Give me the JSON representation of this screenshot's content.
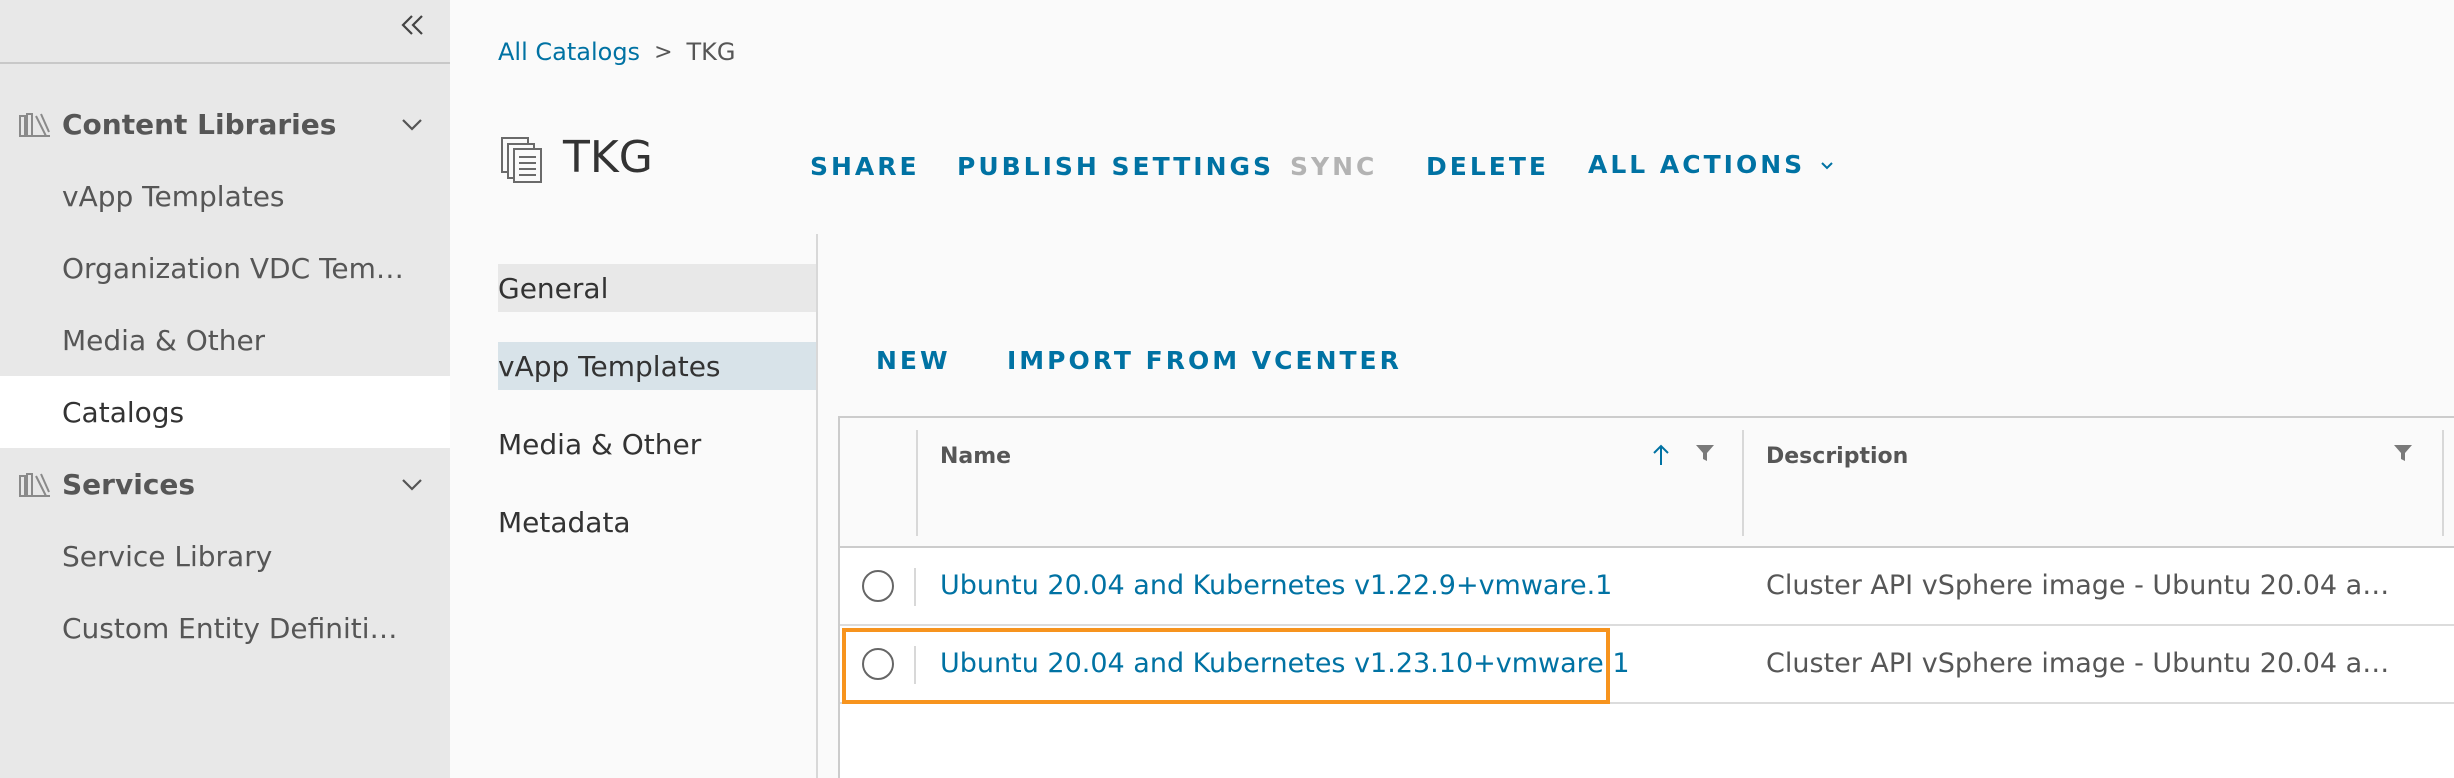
{
  "sidebar": {
    "groups": [
      {
        "label": "Content Libraries",
        "icon": "books-icon",
        "items": [
          {
            "label": "vApp Templates"
          },
          {
            "label": "Organization VDC Templates"
          },
          {
            "label": "Media & Other"
          },
          {
            "label": "Catalogs",
            "active": true
          }
        ]
      },
      {
        "label": "Services",
        "icon": "books-icon",
        "items": [
          {
            "label": "Service Library"
          },
          {
            "label": "Custom Entity Definitions"
          }
        ]
      }
    ]
  },
  "breadcrumb": {
    "parent": "All Catalogs",
    "separator": ">",
    "current": "TKG"
  },
  "page": {
    "title": "TKG"
  },
  "actions": {
    "share": "SHARE",
    "publish_settings": "PUBLISH SETTINGS",
    "sync": "SYNC",
    "delete": "DELETE",
    "all_actions": "ALL ACTIONS"
  },
  "tabs": [
    {
      "label": "General"
    },
    {
      "label": "vApp Templates",
      "selected": true
    },
    {
      "label": "Media & Other"
    },
    {
      "label": "Metadata"
    }
  ],
  "sub_actions": {
    "new": "NEW",
    "import": "IMPORT FROM VCENTER"
  },
  "grid": {
    "columns": {
      "name": "Name",
      "description": "Description"
    },
    "rows": [
      {
        "name": "Ubuntu 20.04 and Kubernetes v1.22.9+vmware.1",
        "description": "Cluster API vSphere image - Ubuntu 20.04 and Kubernetes"
      },
      {
        "name": "Ubuntu 20.04 and Kubernetes v1.23.10+vmware.1",
        "description": "Cluster API vSphere image - Ubuntu 20.04 and Kubernetes",
        "highlighted": true
      }
    ]
  },
  "colors": {
    "link": "#0072a3",
    "highlight": "#f7941e",
    "sidebar_bg": "#e8e8e8",
    "selected_tab": "#d8e3e9"
  }
}
